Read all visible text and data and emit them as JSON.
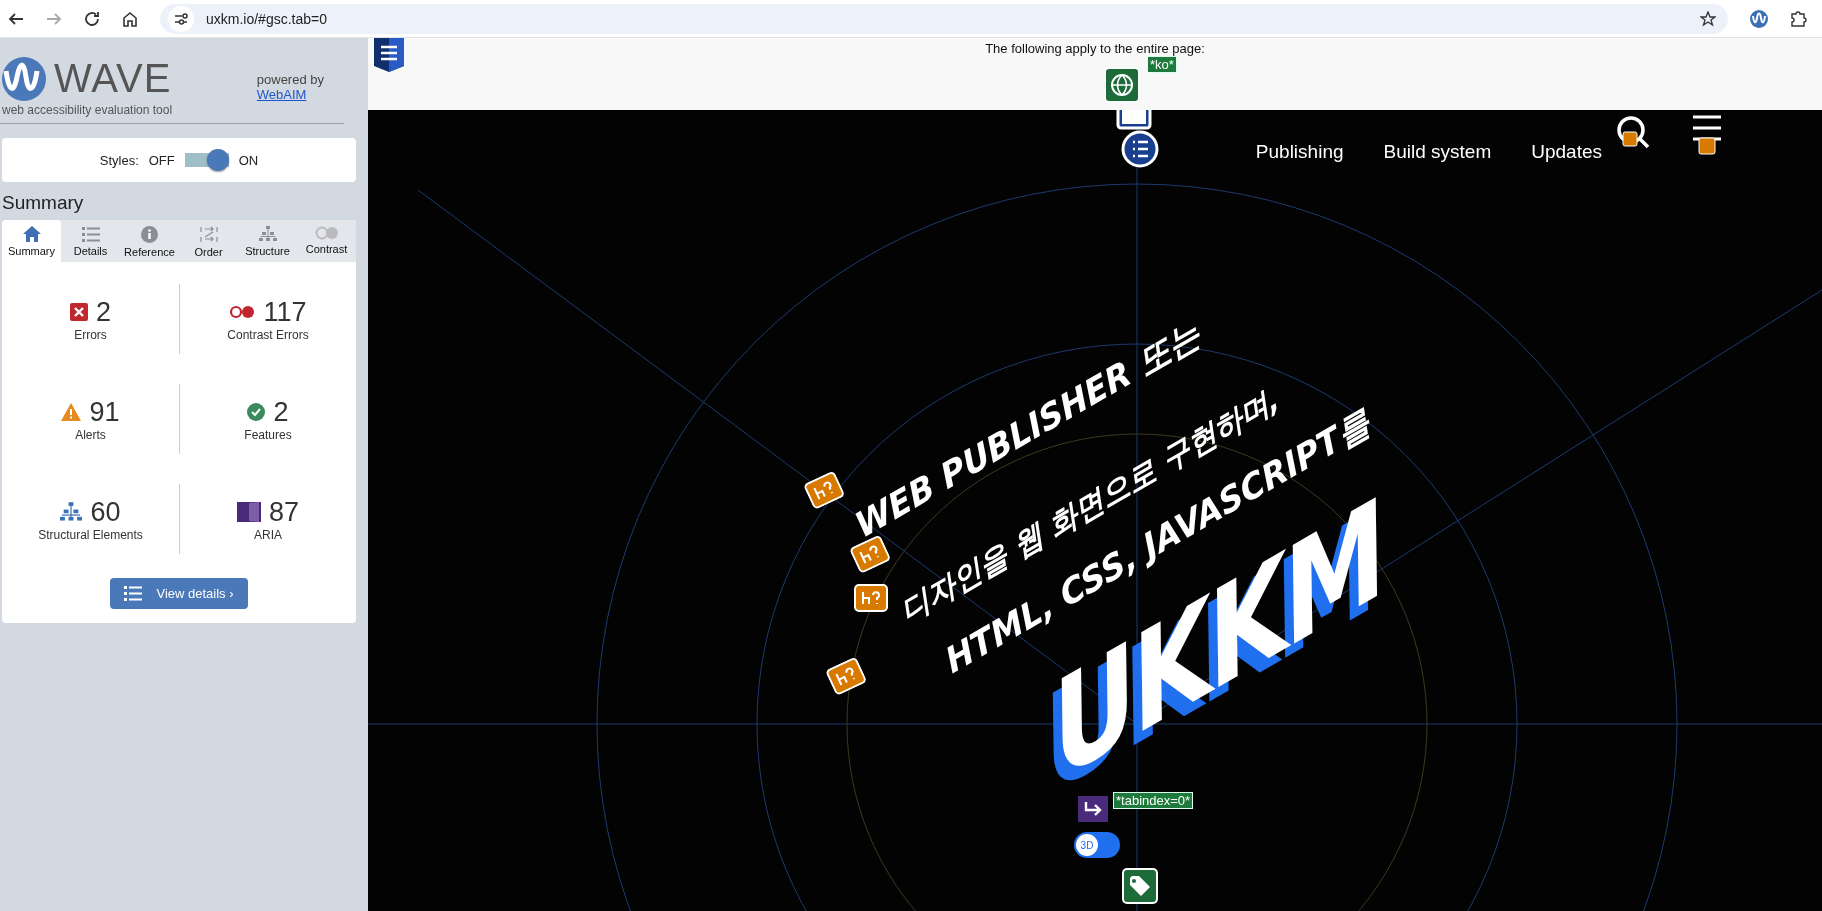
{
  "browser": {
    "url": "uxkm.io/#gsc.tab=0"
  },
  "wave": {
    "logo_text": "WAVE",
    "tagline": "web accessibility evaluation tool",
    "powered_by": "powered by",
    "powered_link": "WebAIM",
    "styles": {
      "label": "Styles:",
      "off_label": "OFF",
      "on_label": "ON",
      "on": true
    },
    "summary_title": "Summary",
    "tabs": [
      {
        "kind": "summary",
        "label": "Summary",
        "selected": true
      },
      {
        "kind": "details",
        "label": "Details",
        "selected": false
      },
      {
        "kind": "reference",
        "label": "Reference",
        "selected": false
      },
      {
        "kind": "order",
        "label": "Order",
        "selected": false
      },
      {
        "kind": "structure",
        "label": "Structure",
        "selected": false
      },
      {
        "kind": "contrast",
        "label": "Contrast",
        "selected": false
      }
    ],
    "stats": [
      {
        "kind": "error",
        "count": "2",
        "label": "Errors"
      },
      {
        "kind": "contrast",
        "count": "117",
        "label": "Contrast Errors"
      },
      {
        "kind": "alert",
        "count": "91",
        "label": "Alerts"
      },
      {
        "kind": "feature",
        "count": "2",
        "label": "Features"
      },
      {
        "kind": "structure",
        "count": "60",
        "label": "Structural Elements"
      },
      {
        "kind": "aria",
        "count": "87",
        "label": "ARIA"
      }
    ],
    "view_details": "View details ›"
  },
  "page": {
    "notice": "The following apply to the entire page:",
    "lang_badge": "*ko*",
    "nav": [
      "Publishing",
      "Build system",
      "Updates"
    ],
    "hero": {
      "lines": [
        "WEB PUBLISHER 또는",
        "디자인을 웹 화면으로 구현하며,",
        "HTML, CSS, JAVASCRIPT를"
      ],
      "logo": "UKKM",
      "tabindex_badge": "*tabindex=0*",
      "toggle_label": "3D"
    }
  }
}
